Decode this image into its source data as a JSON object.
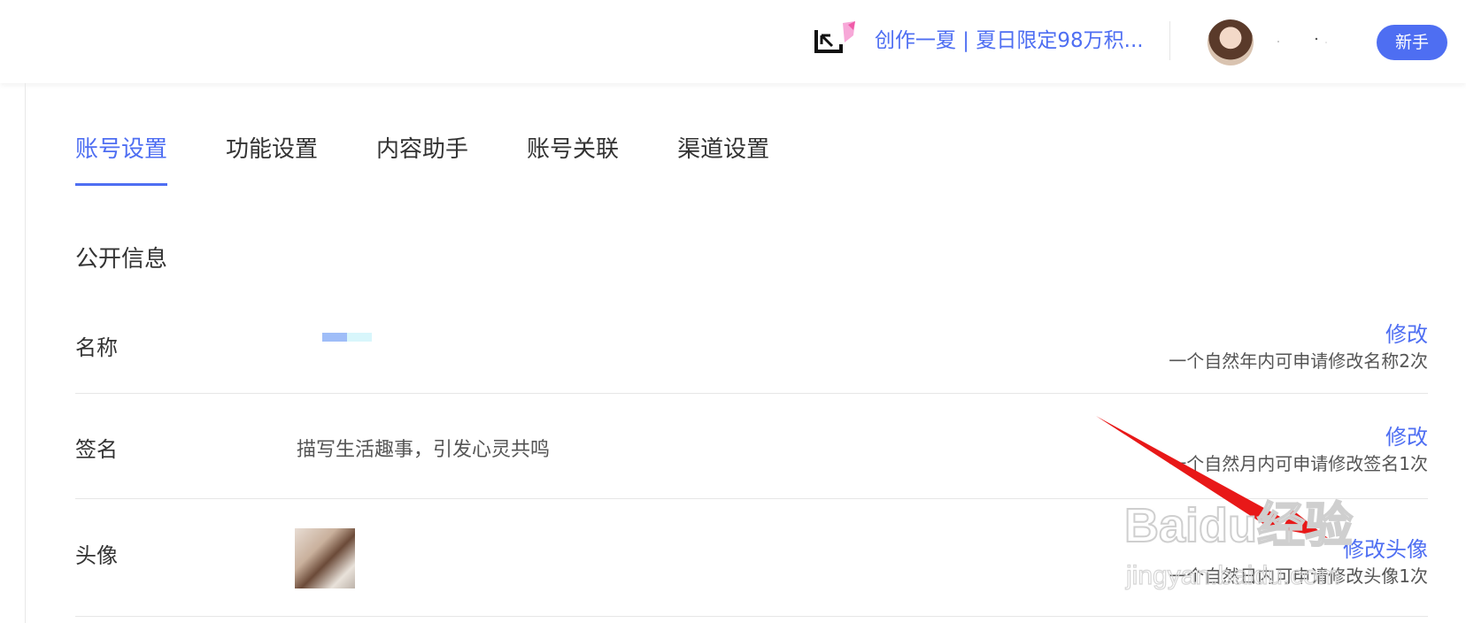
{
  "header": {
    "promo_text": "创作一夏 | 夏日限定98万积...",
    "newbie_button": "新手"
  },
  "tabs": [
    {
      "label": "账号设置",
      "active": true
    },
    {
      "label": "功能设置",
      "active": false
    },
    {
      "label": "内容助手",
      "active": false
    },
    {
      "label": "账号关联",
      "active": false
    },
    {
      "label": "渠道设置",
      "active": false
    }
  ],
  "section_title": "公开信息",
  "rows": [
    {
      "label": "名称",
      "value": "",
      "action": "修改",
      "hint": "一个自然年内可申请修改名称2次"
    },
    {
      "label": "签名",
      "value": "描写生活趣事，引发心灵共鸣",
      "action": "修改",
      "hint": "一个自然月内可申请修改签名1次"
    },
    {
      "label": "头像",
      "value": "",
      "action": "修改头像",
      "hint": "一个自然日内可申请修改头像1次"
    }
  ],
  "watermark": {
    "brand": "Baidu经验",
    "url": "jingyan.baidu.com"
  },
  "colors": {
    "accent": "#4e6ef2",
    "text": "#333333",
    "divider": "#e6e6e6",
    "arrow": "#e81818"
  }
}
